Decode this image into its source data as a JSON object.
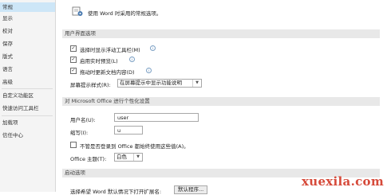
{
  "sidebar": {
    "items": [
      {
        "label": "常规",
        "selected": true
      },
      {
        "label": "显示"
      },
      {
        "label": "校对"
      },
      {
        "label": "保存"
      },
      {
        "label": "版式"
      },
      {
        "label": "语言"
      },
      {
        "label": "高级"
      },
      {
        "label": "自定义功能区"
      },
      {
        "label": "快速访问工具栏"
      },
      {
        "label": "加载项"
      },
      {
        "label": "信任中心"
      }
    ]
  },
  "main": {
    "intro_text": "使用 Word 时采用的常规选项。",
    "ui_options": {
      "header": "用户界面选项",
      "options": [
        {
          "label": "选择时显示浮动工具栏(M)",
          "checked": true
        },
        {
          "label": "启用实时预览(L)",
          "checked": true
        },
        {
          "label": "拖动时更新文档内容(D)",
          "checked": true
        }
      ],
      "screentip_label": "屏幕提示样式(R):",
      "screentip_value": "在屏幕提示中显示功能说明"
    },
    "personalize": {
      "header": "对 Microsoft Office 进行个性化设置",
      "username_label": "用户名(U):",
      "username_value": "user",
      "initials_label": "缩写(I):",
      "initials_value": "u",
      "always_use_label": "不管是否登录到 Office 都始终使用这些值(A)。",
      "always_use_checked": false,
      "theme_label": "Office 主题(T):",
      "theme_value": "白色"
    },
    "startup": {
      "header": "启动选项",
      "choose_label": "选择希望 Word 默认情况下打开扩展名:",
      "default_programs_button": "默认程序..."
    }
  },
  "watermark": "xuexila.com",
  "colors": {
    "selected_nav": "#cde6f7",
    "section_header": "#e8e8e8",
    "watermark": "#d64a3a"
  }
}
